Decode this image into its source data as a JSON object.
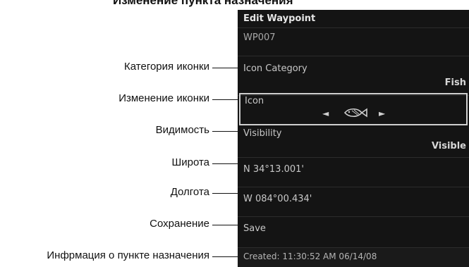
{
  "caption": "Изменение пункта назначения",
  "device_screen": {
    "title": "Edit Waypoint",
    "waypoint_name": "WP007",
    "icon_category_label": "Icon Category",
    "icon_category_value": "Fish",
    "icon_label": "Icon",
    "icon_prev_arrow": "◄",
    "icon_next_arrow": "►",
    "icon_name": "fish-icon",
    "visibility_label": "Visibility",
    "visibility_value": "Visible",
    "latitude": "N 34°13.001'",
    "longitude": "W 084°00.434'",
    "save_label": "Save",
    "created_info": "Created: 11:30:52 AM 06/14/08"
  },
  "callouts": [
    "Категория иконки",
    "Изменение иконки",
    "Видимость",
    "Широта",
    "Долгота",
    "Сохранение",
    "Инфрмация о пункте назначения"
  ]
}
